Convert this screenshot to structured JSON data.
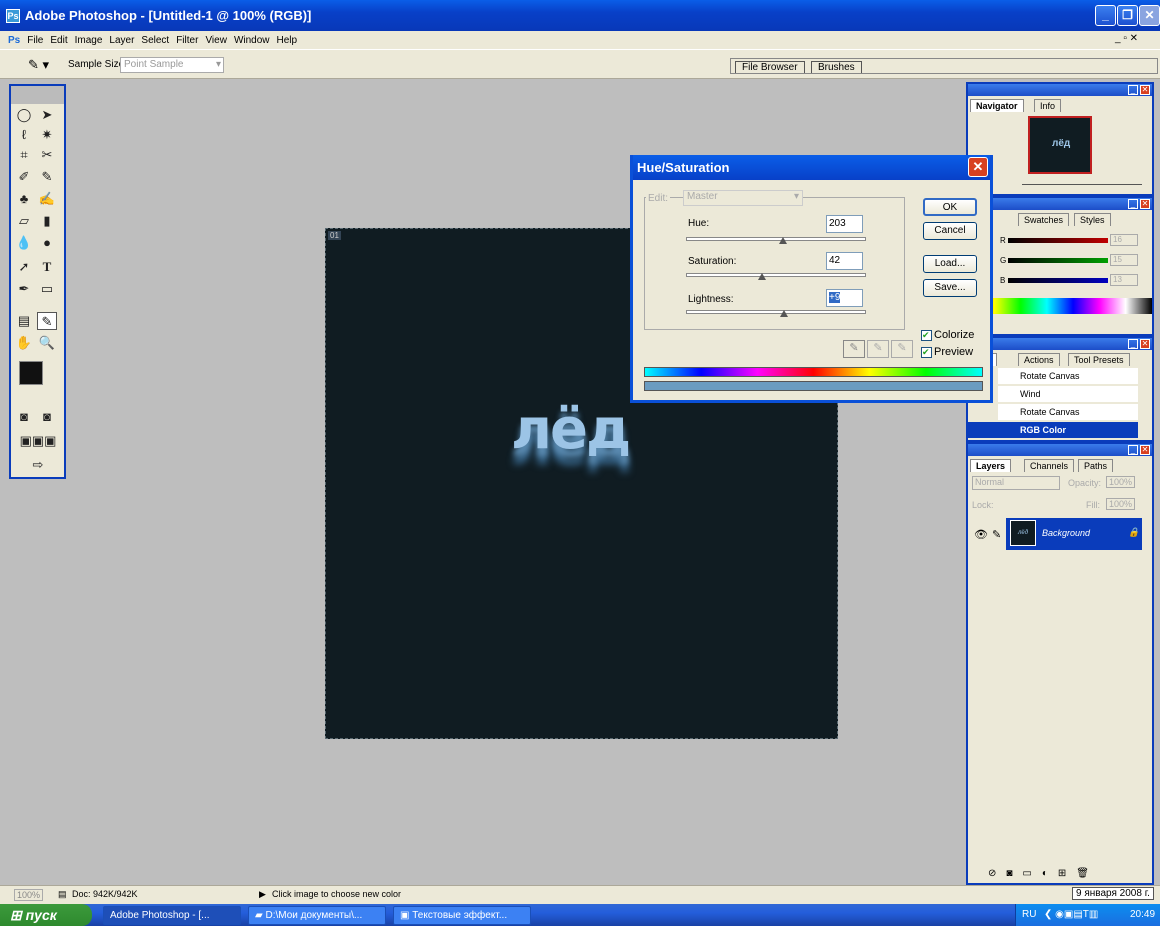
{
  "window": {
    "title": "Adobe Photoshop - [Untitled-1 @ 100% (RGB)]"
  },
  "menu": [
    "File",
    "Edit",
    "Image",
    "Layer",
    "Select",
    "Filter",
    "View",
    "Window",
    "Help"
  ],
  "options_bar": {
    "sample_size_label": "Sample Size:",
    "sample_size_value": "Point Sample",
    "palette_tabs": [
      "File Browser",
      "Brushes"
    ]
  },
  "canvas": {
    "doc_badge": "01",
    "art_text": "лёд"
  },
  "dialog": {
    "title": "Hue/Saturation",
    "edit_label": "Edit:",
    "edit_value": "Master",
    "hue_label": "Hue:",
    "hue_value": "203",
    "hue_level": 0.54,
    "saturation_label": "Saturation:",
    "saturation_value": "42",
    "saturation_level": 0.42,
    "lightness_label": "Lightness:",
    "lightness_value": "+9",
    "lightness_level": 0.545,
    "buttons": {
      "ok": "OK",
      "cancel": "Cancel",
      "load": "Load...",
      "save": "Save..."
    },
    "colorize_label": "Colorize",
    "preview_label": "Preview"
  },
  "navigator": {
    "tabs": [
      "Navigator",
      "Info"
    ],
    "thumb_text": "лёд"
  },
  "color_panel": {
    "tabs": [
      "or",
      "Swatches",
      "Styles"
    ],
    "channels": [
      {
        "name": "R",
        "value": "16",
        "color": "#c00000"
      },
      {
        "name": "G",
        "value": "15",
        "color": "#00a000"
      },
      {
        "name": "B",
        "value": "13",
        "color": "#0000c0"
      }
    ]
  },
  "history_panel": {
    "tabs": [
      "tory",
      "Actions",
      "Tool Presets"
    ],
    "items": [
      "Rotate Canvas",
      "Wind",
      "Rotate Canvas",
      "RGB Color"
    ]
  },
  "layers_panel": {
    "tabs": [
      "Layers",
      "Channels",
      "Paths"
    ],
    "blend_mode": "Normal",
    "opacity_label": "Opacity:",
    "opacity_value": "100%",
    "lock_label": "Lock:",
    "fill_label": "Fill:",
    "fill_value": "100%",
    "layer_name": "Background",
    "layer_thumb_text": "лёд"
  },
  "status": {
    "zoom": "100%",
    "doc": "Doc: 942K/942K",
    "hint": "Click image to choose new color",
    "date": "9 января 2008 г."
  },
  "taskbar": {
    "start": "пуск",
    "items": [
      "Adobe Photoshop - [...",
      "D:\\Мои документы\\...",
      "Текстовые эффект..."
    ],
    "lang": "RU",
    "time": "20:49"
  }
}
